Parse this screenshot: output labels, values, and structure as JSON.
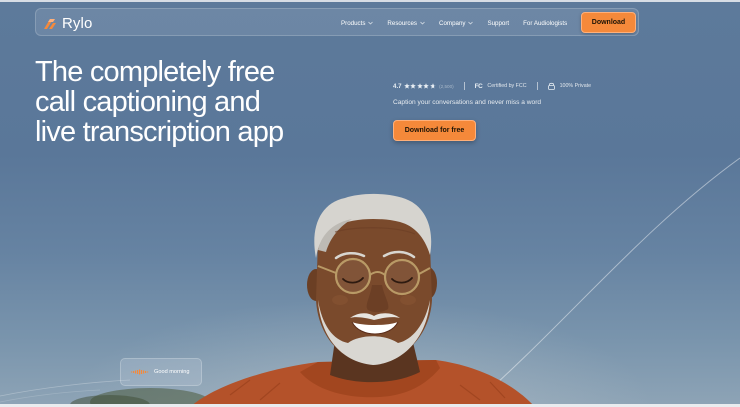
{
  "brand": {
    "name": "Rylo",
    "accent": "#f5893a",
    "logo_icon": "rylo-logo-icon"
  },
  "nav": {
    "items": [
      {
        "label": "Products",
        "dropdown": true
      },
      {
        "label": "Resources",
        "dropdown": true
      },
      {
        "label": "Company",
        "dropdown": true
      },
      {
        "label": "Support",
        "dropdown": false
      },
      {
        "label": "For Audiologists",
        "dropdown": false
      }
    ],
    "download_label": "Download"
  },
  "hero": {
    "headline": [
      "The completely free",
      "call captioning and",
      "live transcription app"
    ],
    "rating_value": "4.7",
    "rating_stars": 4.7,
    "reviews_text": "(2,500)",
    "fcc_mark": "FC",
    "certified_text": "Certified by FCC",
    "privacy_text": "100% Private",
    "tagline": "Caption your conversations and never miss a word",
    "cta_label": "Download for free"
  },
  "caption_bubble": {
    "text": "Good morning",
    "icon": "waveform-icon"
  },
  "colors": {
    "sky_top": "#5d7a9b",
    "sky_bottom": "#8ea4b6",
    "button": "#f5893a",
    "sweater": "#b4522a"
  }
}
